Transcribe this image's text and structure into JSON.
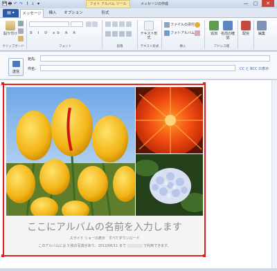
{
  "titlebar": {
    "context_tab": "フォト アルバム ツール",
    "app_title": "メッセージの作成",
    "buttons": {
      "minimize": "—",
      "maximize": "▢",
      "close": "✕"
    }
  },
  "quick_access": {
    "save": "💾",
    "print": "🖶",
    "undo": "↶",
    "redo": "↷",
    "flag": "!",
    "down": "↓",
    "menu": "▾"
  },
  "tabs": {
    "file": "▤ ▾",
    "message": "メッセージ",
    "insert": "挿入",
    "options": "オプション",
    "format": "形式"
  },
  "ribbon": {
    "clipboard": {
      "paste": "貼り付け",
      "group": "クリップボード"
    },
    "font": {
      "group": "フォント"
    },
    "paragraph": {
      "group": "段落"
    },
    "text_format": {
      "label": "テキスト形式",
      "group": "テキスト形式"
    },
    "insert": {
      "attach_file": "ファイルの添付",
      "photo_album": "フォトアルバム",
      "group": "挿入"
    },
    "address_book": {
      "add": "追加",
      "check_names": "名前の確認",
      "group": "アドレス帳"
    },
    "delivery": {
      "label": "配信"
    },
    "edit": {
      "label": "編集"
    }
  },
  "header": {
    "send_label": "送信",
    "to_label": "宛先:",
    "subject_label": "件名:",
    "to_value": "",
    "subject_value": "",
    "cc_link": "CC と BCC の表示"
  },
  "album": {
    "title": "ここにアルバムの名前を入力します",
    "links": "スライド ショーの表示　すべてダウンロード",
    "note_prefix": "このアルバムには 3 枚の写真があり、2012/06/11 まで",
    "note_suffix": "で利用できます。"
  },
  "colors": {
    "frame_border": "#e02020",
    "accent": "#2a5ba6"
  }
}
